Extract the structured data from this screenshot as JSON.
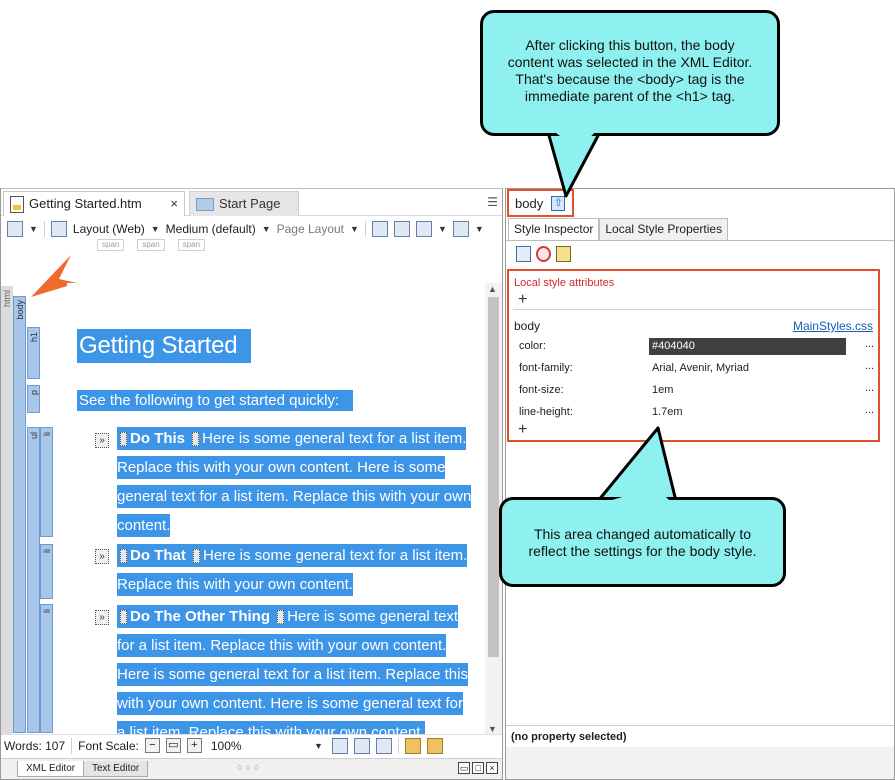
{
  "callouts": {
    "top": "After clicking this button, the body\ncontent was selected in the XML Editor.\nThat's because the <body> tag is the\nimmediate parent of the <h1> tag.",
    "bottom": "This area changed automatically to\nreflect the settings for the body style."
  },
  "editor": {
    "tabs": [
      {
        "label": "Getting Started.htm",
        "active": true
      },
      {
        "label": "Start Page",
        "active": false
      }
    ],
    "toolbar": {
      "layout": "Layout (Web)",
      "medium": "Medium (default)",
      "page_layout": "Page Layout"
    },
    "span_tags": [
      "span",
      "span",
      "span"
    ],
    "structure_labels": {
      "html": "html",
      "body": "body",
      "h1": "h1",
      "p": "p",
      "ul": "ul",
      "li": "li"
    },
    "content": {
      "heading": "Getting Started",
      "intro": "See the following to get started quickly:",
      "bullet_marker": "»",
      "items": [
        {
          "title": "Do This",
          "text": "Here is some general text for a list item. Replace this with your own content. Here is some general text for a list item. Replace this with your own content."
        },
        {
          "title": "Do That",
          "text": "Here is some general text for a list item. Replace this with your own content."
        },
        {
          "title": "Do The Other Thing",
          "text": "Here is some general text for a list item. Replace this with your own content. Here is some general text for a list item. Replace this with your own content. Here is some general text for a list item. Replace this with your own content."
        }
      ]
    },
    "status": {
      "words": "Words: 107",
      "font_scale_label": "Font Scale:",
      "zoom": "100%"
    },
    "bottom_tabs": [
      "XML Editor",
      "Text Editor"
    ]
  },
  "inspector": {
    "breadcrumb": "body",
    "tabs": [
      "Style Inspector",
      "Local Style Properties"
    ],
    "local_style_attributes": "Local style attributes",
    "selector": "body",
    "stylesheet": "MainStyles.css",
    "properties": [
      {
        "name": "color:",
        "value": "#404040"
      },
      {
        "name": "font-family:",
        "value": "Arial, Avenir, Myriad"
      },
      {
        "name": "font-size:",
        "value": "1em"
      },
      {
        "name": "line-height:",
        "value": "1.7em"
      }
    ],
    "ellipsis": "...",
    "plus": "+",
    "status": "(no property selected)"
  },
  "colors": {
    "selection": "#3d95e8",
    "callout_fill": "#8ff0f0",
    "highlight_border": "#e0502a",
    "value_highlight": "#404040",
    "link": "#1a5fb4",
    "local_attr_label": "#d12c2c"
  }
}
